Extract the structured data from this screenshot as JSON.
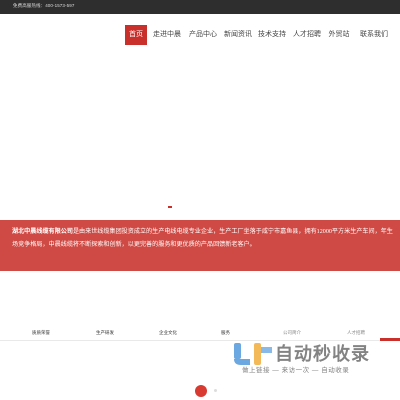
{
  "topbar": {
    "hotline": "免费高服热线：400-1573-597"
  },
  "nav": {
    "items": [
      {
        "label": "首页"
      },
      {
        "label": "走进中晨"
      },
      {
        "label": "产品中心"
      },
      {
        "label": "新闻资讯"
      },
      {
        "label": "技术支持"
      },
      {
        "label": "人才招聘"
      },
      {
        "label": "外贸站"
      },
      {
        "label": "联系我们"
      }
    ]
  },
  "banner": {
    "company": "湖北中晨线缆有限公司",
    "line1_rest": "是由来世线缆集团投资成立的生产电线电缆专业企业，生产工厂坐落于咸宁市嘉鱼县，拥有12000平方米生产车间，年生产能力75亿，面对新的市",
    "line2": "场竞争格局，中晨线缆将不断探索和创新，以更完善的服务和更优质的产品回馈新老客户。",
    "line3": ""
  },
  "tabs": [
    {
      "label": "质质荣誉"
    },
    {
      "label": "生产研发"
    },
    {
      "label": "企业文化"
    },
    {
      "label": "服务"
    },
    {
      "label": "公司简介"
    },
    {
      "label": "人才招聘"
    }
  ],
  "watermark": {
    "title": "自动秒收录",
    "subtitle": "做上链接 — 来访一次 — 自动收录"
  },
  "colors": {
    "accent": "#c9302c",
    "banner": "#cf4a44",
    "topbar": "#2e2e2e"
  }
}
